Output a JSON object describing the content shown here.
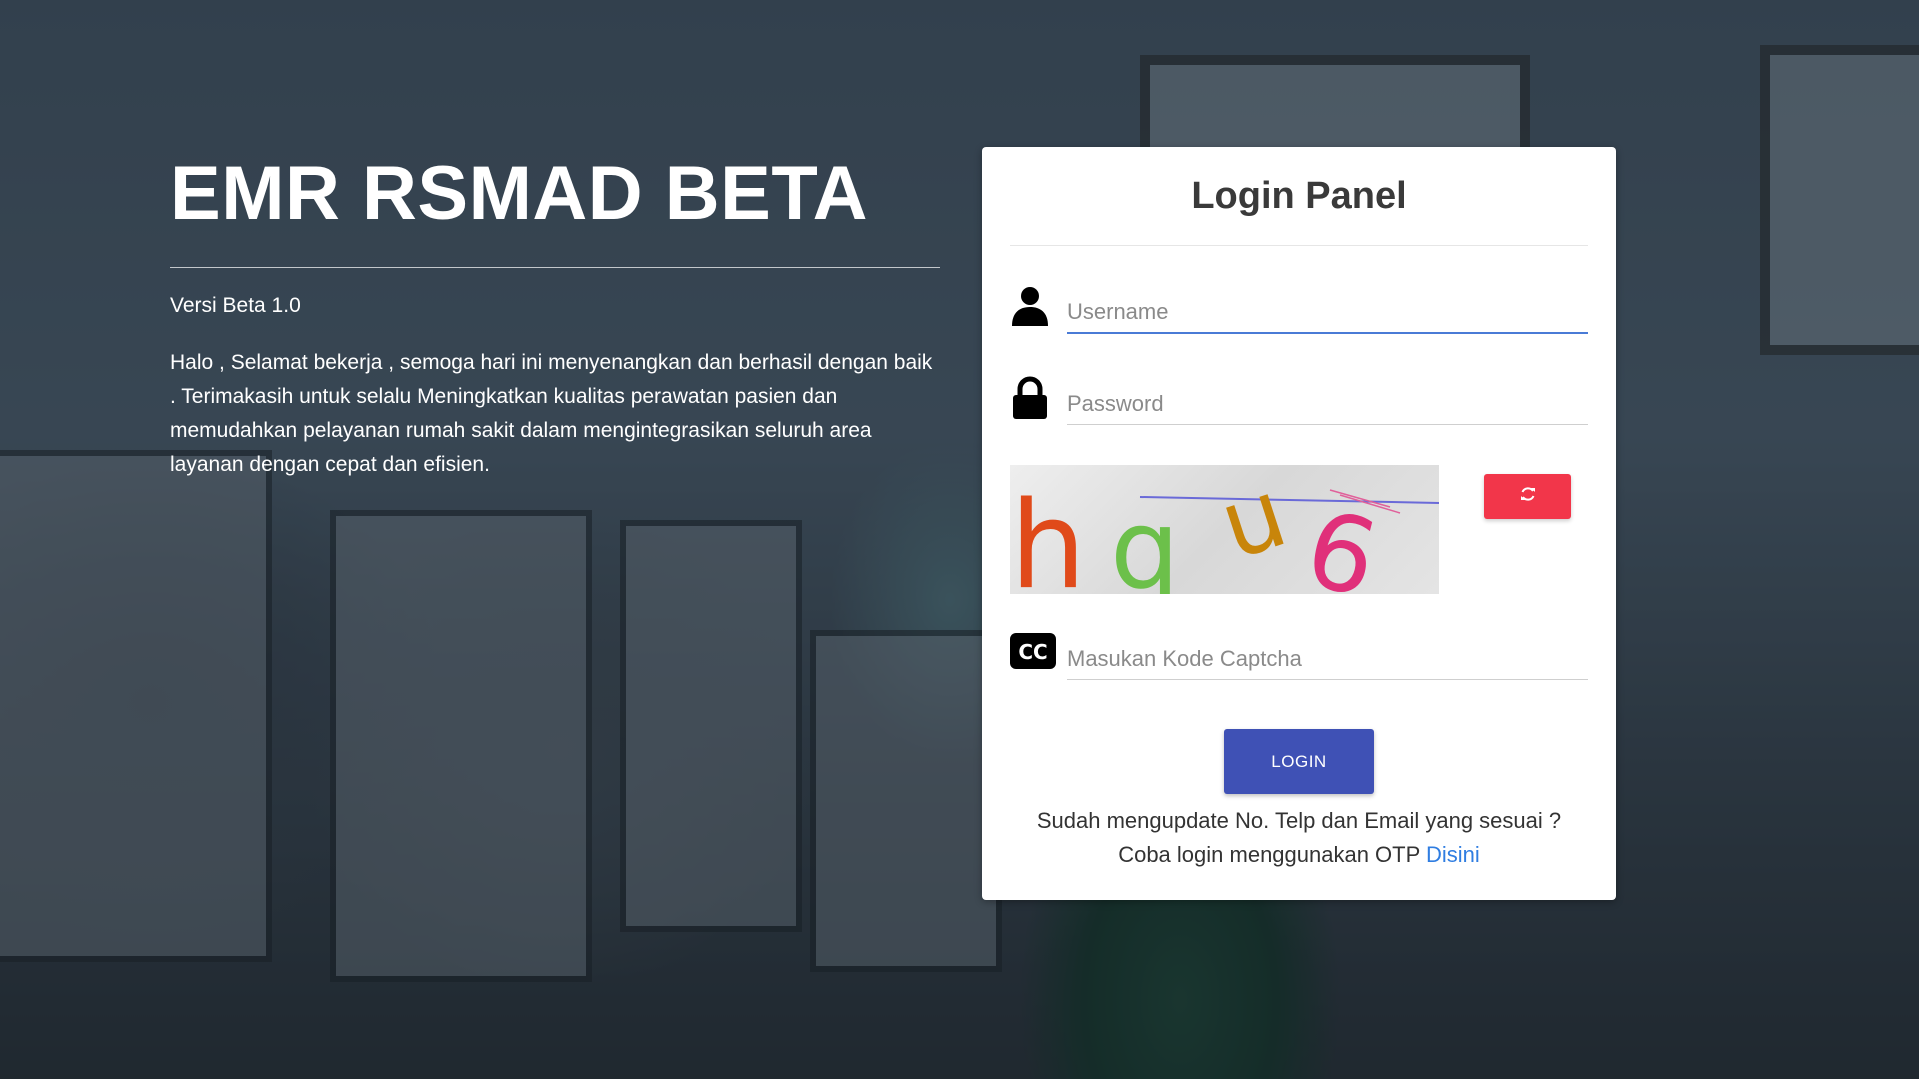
{
  "intro": {
    "title": "EMR RSMAD BETA",
    "version": "Versi Beta 1.0",
    "message": "Halo , Selamat bekerja , semoga hari ini menyenangkan dan berhasil dengan baik . Terimakasih untuk selalu Meningkatkan kualitas perawatan pasien dan memudahkan pelayanan rumah sakit dalam mengintegrasikan seluruh area layanan dengan cepat dan efisien."
  },
  "panel": {
    "title": "Login Panel",
    "username_placeholder": "Username",
    "password_placeholder": "Password",
    "captcha_placeholder": "Masukan Kode Captcha",
    "captcha_text": "hqu6",
    "login_label": "LOGIN",
    "otp_line1": "Sudah mengupdate No. Telp dan Email yang sesuai ?",
    "otp_line2": "Coba login menggunakan OTP ",
    "otp_link": "Disini"
  },
  "icons": {
    "username": "user-icon",
    "password": "lock-icon",
    "captcha": "closed-caption-icon",
    "refresh": "refresh-icon"
  },
  "colors": {
    "login_button": "#3f51b5",
    "refresh_button": "#f2364a",
    "link": "#2f7de1",
    "active_input_underline": "#4a7bd6"
  }
}
